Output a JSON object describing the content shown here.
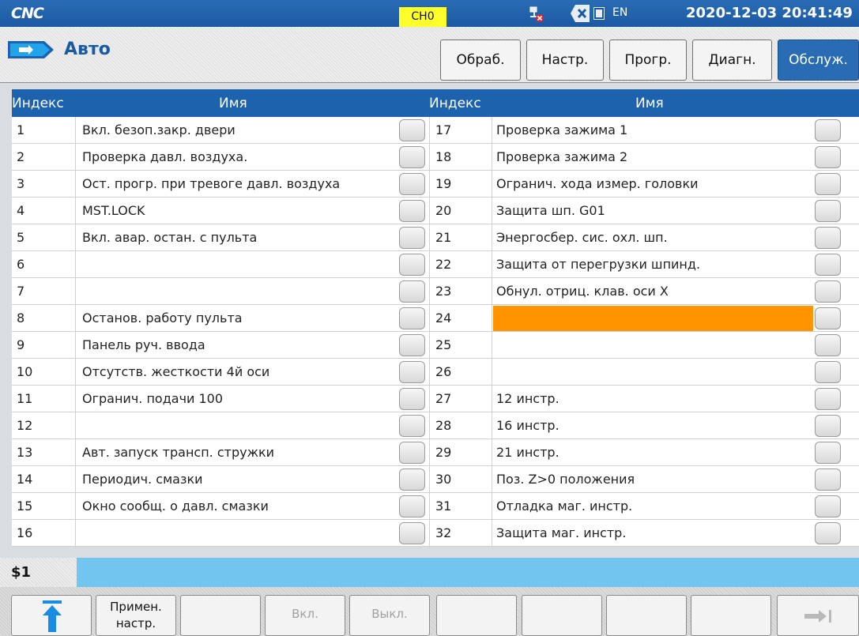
{
  "header": {
    "logo_text": "CNC",
    "channel": "CH0",
    "language": "EN",
    "datetime": "2020-12-03 20:41:49"
  },
  "mode": {
    "title": "Авто",
    "tabs": [
      "Обраб.",
      "Настр.",
      "Прогр.",
      "Диагн.",
      "Обслуж."
    ],
    "active_tab": "Обслуж."
  },
  "table": {
    "col_index": "Индекс",
    "col_name": "Имя",
    "left": [
      {
        "idx": "1",
        "name": "Вкл. безоп.закр. двери"
      },
      {
        "idx": "2",
        "name": "Проверка давл. воздуха."
      },
      {
        "idx": "3",
        "name": "Ост. прогр. при тревоге давл. воздуха"
      },
      {
        "idx": "4",
        "name": "MST.LOCK"
      },
      {
        "idx": "5",
        "name": "Вкл. авар. остан. с пульта"
      },
      {
        "idx": "6",
        "name": ""
      },
      {
        "idx": "7",
        "name": ""
      },
      {
        "idx": "8",
        "name": "Останов. работу пульта"
      },
      {
        "idx": "9",
        "name": "Панель руч. ввода"
      },
      {
        "idx": "10",
        "name": "Отсутств. жесткости 4й оси"
      },
      {
        "idx": "11",
        "name": "Огранич. подачи 100"
      },
      {
        "idx": "12",
        "name": ""
      },
      {
        "idx": "13",
        "name": "Авт. запуск трансп. стружки"
      },
      {
        "idx": "14",
        "name": "Периодич. смазки"
      },
      {
        "idx": "15",
        "name": "Окно сообщ. о давл. смазки"
      },
      {
        "idx": "16",
        "name": ""
      }
    ],
    "right": [
      {
        "idx": "17",
        "name": "Проверка зажима 1"
      },
      {
        "idx": "18",
        "name": "Проверка зажима 2"
      },
      {
        "idx": "19",
        "name": "Огранич. хода измер. головки"
      },
      {
        "idx": "20",
        "name": "Защита шп. G01"
      },
      {
        "idx": "21",
        "name": "Энергосбер. сис. охл. шп."
      },
      {
        "idx": "22",
        "name": "Защита от перегрузки шпинд."
      },
      {
        "idx": "23",
        "name": "Обнул. отриц. клав. оси X"
      },
      {
        "idx": "24",
        "name": ""
      },
      {
        "idx": "25",
        "name": ""
      },
      {
        "idx": "26",
        "name": ""
      },
      {
        "idx": "27",
        "name": "12 инстр."
      },
      {
        "idx": "28",
        "name": "16 инстр."
      },
      {
        "idx": "29",
        "name": "21 инстр."
      },
      {
        "idx": "30",
        "name": "Поз. Z>0 положения"
      },
      {
        "idx": "31",
        "name": "Отладка маг. инстр."
      },
      {
        "idx": "32",
        "name": "Защита маг. инстр."
      }
    ],
    "selected_index": "24",
    "highlight_color": "#ff9400"
  },
  "command": {
    "prompt": "$1",
    "value": ""
  },
  "softkeys": [
    {
      "label": "",
      "icon": "up-arrow-icon",
      "enabled": true
    },
    {
      "label": "Примен. настр.",
      "enabled": true
    },
    {
      "label": "",
      "enabled": false
    },
    {
      "label": "Вкл.",
      "enabled": false
    },
    {
      "label": "Выкл.",
      "enabled": false
    },
    {
      "label": "",
      "enabled": false
    },
    {
      "label": "",
      "enabled": false
    },
    {
      "label": "",
      "enabled": false
    },
    {
      "label": "",
      "enabled": false
    },
    {
      "label": "",
      "icon": "next-page-icon",
      "enabled": true
    }
  ],
  "colors": {
    "header_blue": "#1d62ac",
    "command_bg": "#72c5ee",
    "channel_bg": "#ffff2a"
  }
}
